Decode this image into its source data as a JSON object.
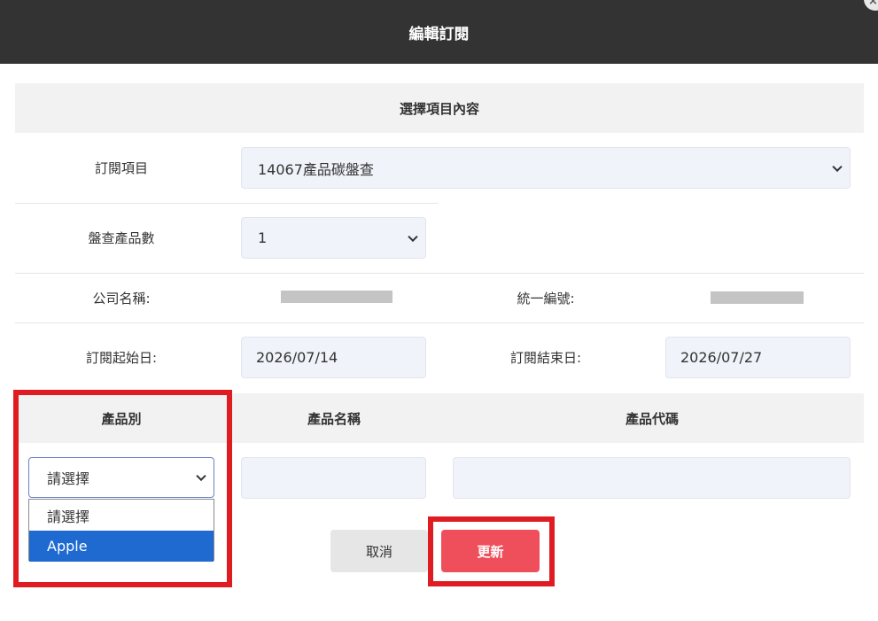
{
  "header": {
    "title": "編輯訂閱",
    "close_icon": "×"
  },
  "section": {
    "title": "選擇項目內容"
  },
  "fields": {
    "subscription_item": {
      "label": "訂閱項目",
      "value": "14067產品碳盤查"
    },
    "product_count": {
      "label": "盤查產品數",
      "value": "1"
    },
    "company_name": {
      "label": "公司名稱:"
    },
    "tax_id": {
      "label": "統一編號:"
    },
    "start_date": {
      "label": "訂閱起始日:",
      "value": "2026/07/14"
    },
    "end_date": {
      "label": "訂閱結束日:",
      "value": "2026/07/27"
    }
  },
  "product_table": {
    "headers": [
      "產品別",
      "產品名稱",
      "產品代碼"
    ],
    "category_select": {
      "value": "請選擇",
      "options": [
        "請選擇",
        "Apple"
      ],
      "highlighted_index": 1
    }
  },
  "buttons": {
    "cancel": "取消",
    "update": "更新"
  },
  "colors": {
    "header_bg": "#333333",
    "update_button": "#ef4f5b",
    "highlight_box": "#e01c23",
    "option_highlight": "#1e6ad1"
  }
}
